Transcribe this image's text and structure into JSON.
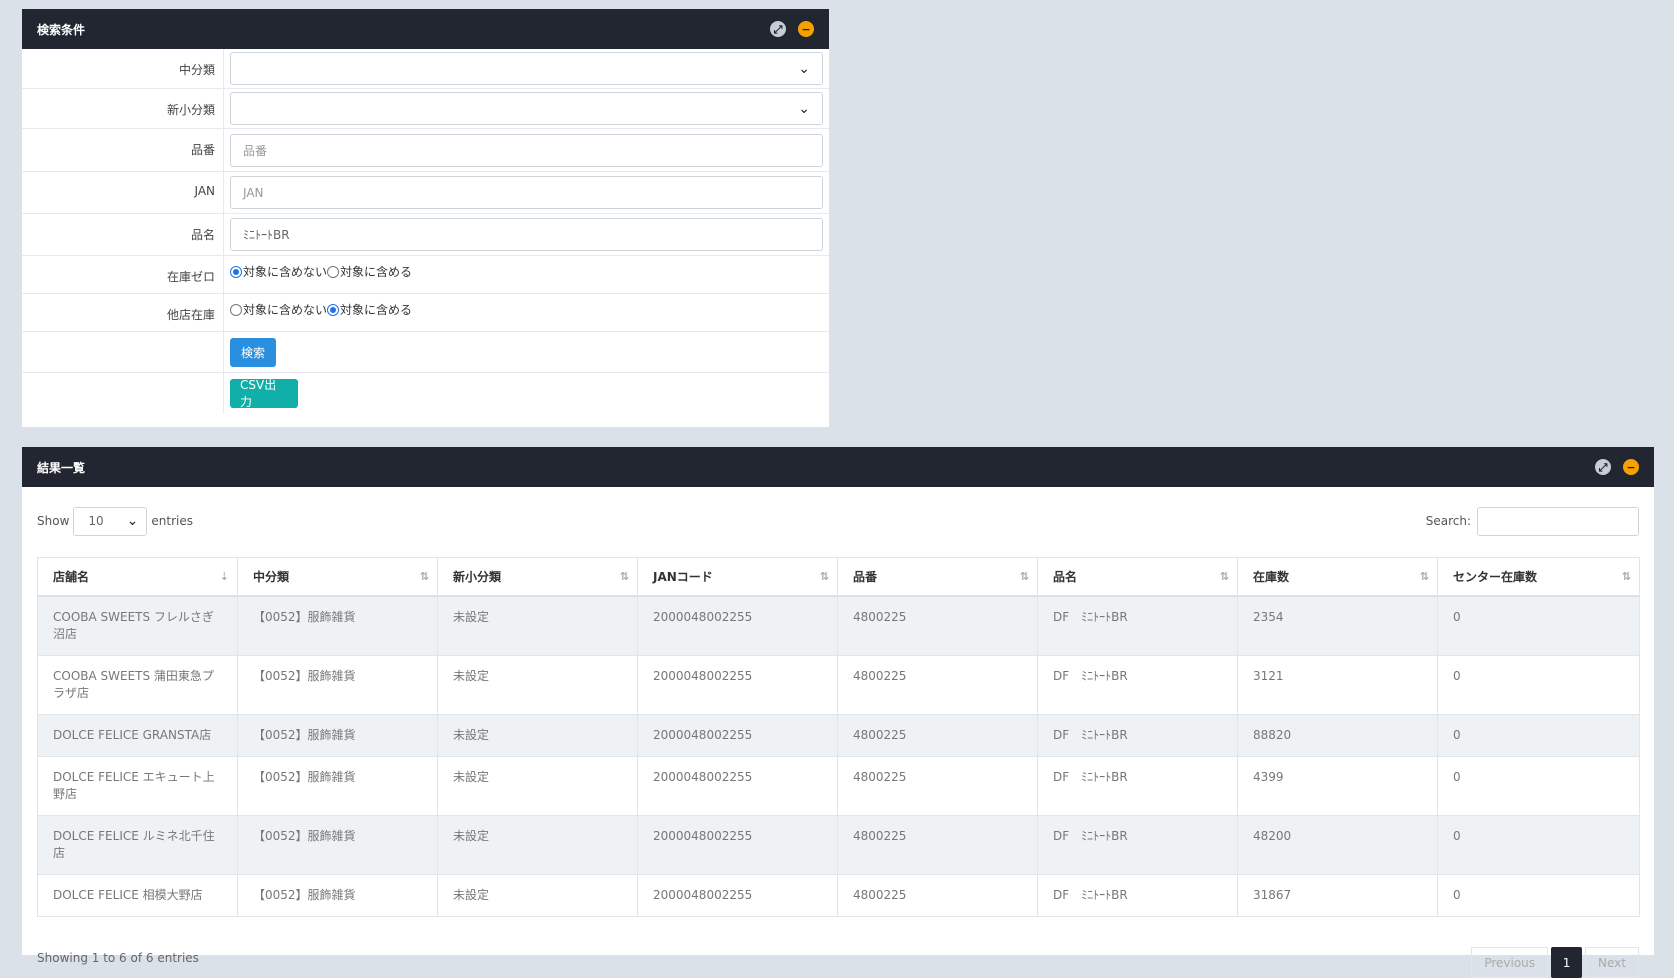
{
  "search_panel": {
    "title": "検索条件",
    "fields": {
      "chubunrui_label": "中分類",
      "shinshobunrui_label": "新小分類",
      "hinban_label": "品番",
      "hinban_placeholder": "品番",
      "jan_label": "JAN",
      "jan_placeholder": "JAN",
      "hinmei_label": "品名",
      "hinmei_value": "ﾐﾆﾄｰﾄBR",
      "zaiko_zero_label": "在庫ゼロ",
      "zaiko_zero_opt1": "対象に含めない",
      "zaiko_zero_opt2": "対象に含める",
      "taten_label": "他店在庫",
      "taten_opt1": "対象に含めない",
      "taten_opt2": "対象に含める"
    },
    "search_button": "検索",
    "csv_button": "CSV出力",
    "select_arrow": "⌄"
  },
  "result_panel": {
    "title": "結果一覧",
    "show_label": "Show",
    "entries_value": "10",
    "entries_label": "entries",
    "search_label": "Search:",
    "columns": [
      "店舗名",
      "中分類",
      "新小分類",
      "JANコード",
      "品番",
      "品名",
      "在庫数",
      "センター在庫数"
    ],
    "rows": [
      [
        "COOBA SWEETS フレルさぎ沼店",
        "【0052】服飾雑貨",
        "未設定",
        "2000048002255",
        "4800225",
        "DF　ﾐﾆﾄｰﾄBR",
        "2354",
        "0"
      ],
      [
        "COOBA SWEETS 蒲田東急プラザ店",
        "【0052】服飾雑貨",
        "未設定",
        "2000048002255",
        "4800225",
        "DF　ﾐﾆﾄｰﾄBR",
        "3121",
        "0"
      ],
      [
        "DOLCE FELICE GRANSTA店",
        "【0052】服飾雑貨",
        "未設定",
        "2000048002255",
        "4800225",
        "DF　ﾐﾆﾄｰﾄBR",
        "88820",
        "0"
      ],
      [
        "DOLCE FELICE エキュート上野店",
        "【0052】服飾雑貨",
        "未設定",
        "2000048002255",
        "4800225",
        "DF　ﾐﾆﾄｰﾄBR",
        "4399",
        "0"
      ],
      [
        "DOLCE FELICE ルミネ北千住店",
        "【0052】服飾雑貨",
        "未設定",
        "2000048002255",
        "4800225",
        "DF　ﾐﾆﾄｰﾄBR",
        "48200",
        "0"
      ],
      [
        "DOLCE FELICE 相模大野店",
        "【0052】服飾雑貨",
        "未設定",
        "2000048002255",
        "4800225",
        "DF　ﾐﾆﾄｰﾄBR",
        "31867",
        "0"
      ]
    ],
    "info": "Showing 1 to 6 of 6 entries",
    "pagination": {
      "previous": "Previous",
      "current": "1",
      "next": "Next"
    }
  },
  "icons": {
    "expand": "expand-icon",
    "collapse": "collapse-icon"
  },
  "colors": {
    "header_bg": "#212630",
    "primary": "#2b8fe0",
    "teal": "#10b0a8",
    "collapse": "#f5a100"
  }
}
